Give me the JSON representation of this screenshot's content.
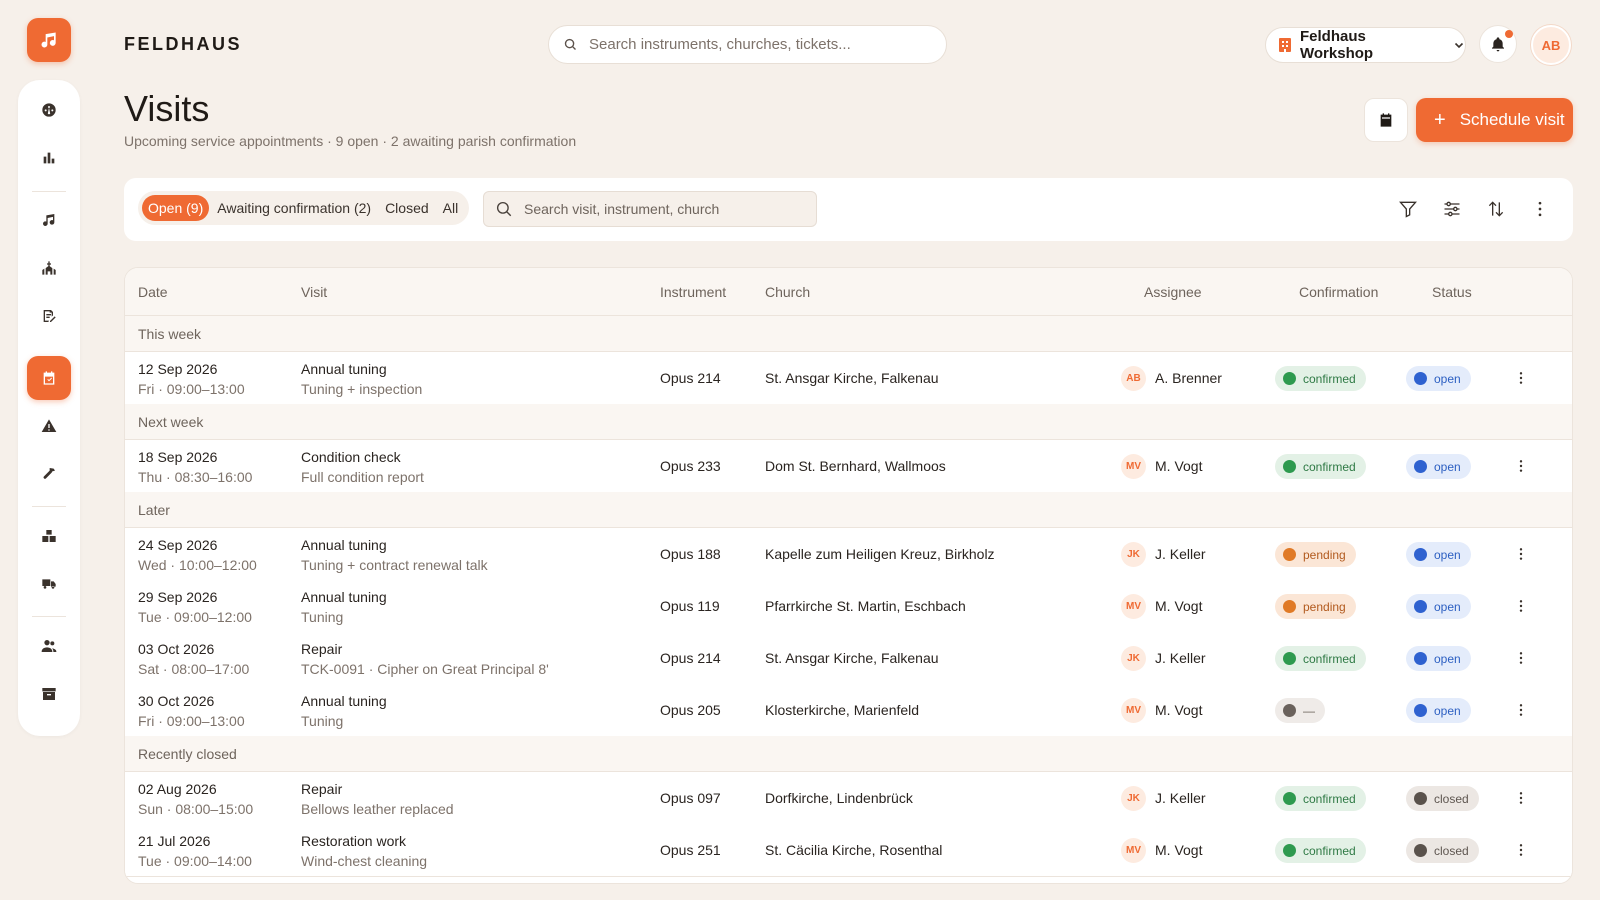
{
  "app": {
    "brand": "FELDHAUS",
    "search_placeholder": "Search instruments, churches, tickets...",
    "workspace": "Feldhaus Workshop",
    "user_initials": "AB"
  },
  "sidebar": {
    "items": [
      {
        "icon": "dashboard-icon"
      },
      {
        "icon": "chart-icon"
      },
      {
        "icon": "music-note-icon"
      },
      {
        "icon": "church-icon"
      },
      {
        "icon": "contract-icon"
      },
      {
        "icon": "calendar-icon",
        "active": true
      },
      {
        "icon": "warning-icon"
      },
      {
        "icon": "hammer-icon"
      },
      {
        "icon": "boxes-icon"
      },
      {
        "icon": "truck-icon"
      },
      {
        "icon": "users-icon"
      },
      {
        "icon": "archive-icon"
      }
    ]
  },
  "page": {
    "title": "Visits",
    "subtitle": "Upcoming service appointments · 9 open · 2 awaiting parish confirmation",
    "primary_action": "Schedule visit"
  },
  "filters": {
    "tabs": [
      "Open (9)",
      "Awaiting confirmation (2)",
      "Closed",
      "All"
    ],
    "active_tab": 0,
    "search_placeholder": "Search visit, instrument, church"
  },
  "table": {
    "columns": [
      "Date",
      "Visit",
      "Instrument",
      "Church",
      "Assignee",
      "Confirmation",
      "Status"
    ],
    "groups": [
      {
        "label": "This week",
        "rows": [
          {
            "date": "12 Sep 2026",
            "time": "Fri · 09:00–13:00",
            "visit": "Annual tuning",
            "visit_sub": "Tuning + inspection",
            "instrument": "Opus 214",
            "church": "St. Ansgar Kirche, Falkenau",
            "initials": "AB",
            "assignee": "A. Brenner",
            "confirmation": "confirmed",
            "status": "open"
          }
        ]
      },
      {
        "label": "Next week",
        "rows": [
          {
            "date": "18 Sep 2026",
            "time": "Thu · 08:30–16:00",
            "visit": "Condition check",
            "visit_sub": "Full condition report",
            "instrument": "Opus 233",
            "church": "Dom St. Bernhard, Wallmoos",
            "initials": "MV",
            "assignee": "M. Vogt",
            "confirmation": "confirmed",
            "status": "open"
          }
        ]
      },
      {
        "label": "Later",
        "rows": [
          {
            "date": "24 Sep 2026",
            "time": "Wed · 10:00–12:00",
            "visit": "Annual tuning",
            "visit_sub": "Tuning + contract renewal talk",
            "instrument": "Opus 188",
            "church": "Kapelle zum Heiligen Kreuz, Birkholz",
            "initials": "JK",
            "assignee": "J. Keller",
            "confirmation": "pending",
            "status": "open"
          },
          {
            "date": "29 Sep 2026",
            "time": "Tue · 09:00–12:00",
            "visit": "Annual tuning",
            "visit_sub": "Tuning",
            "instrument": "Opus 119",
            "church": "Pfarrkirche St. Martin, Eschbach",
            "initials": "MV",
            "assignee": "M. Vogt",
            "confirmation": "pending",
            "status": "open"
          },
          {
            "date": "03 Oct 2026",
            "time": "Sat · 08:00–17:00",
            "visit": "Repair",
            "visit_sub": "TCK-0091 · Cipher on Great Principal 8'",
            "instrument": "Opus 214",
            "church": "St. Ansgar Kirche, Falkenau",
            "initials": "JK",
            "assignee": "J. Keller",
            "confirmation": "confirmed",
            "status": "open"
          },
          {
            "date": "30 Oct 2026",
            "time": "Fri · 09:00–13:00",
            "visit": "Annual tuning",
            "visit_sub": "Tuning",
            "instrument": "Opus 205",
            "church": "Klosterkirche, Marienfeld",
            "initials": "MV",
            "assignee": "M. Vogt",
            "confirmation": "—",
            "status": "open"
          }
        ]
      },
      {
        "label": "Recently closed",
        "rows": [
          {
            "date": "02 Aug 2026",
            "time": "Sun · 08:00–15:00",
            "visit": "Repair",
            "visit_sub": "Bellows leather replaced",
            "instrument": "Opus 097",
            "church": "Dorfkirche, Lindenbrück",
            "initials": "JK",
            "assignee": "J. Keller",
            "confirmation": "confirmed",
            "status": "closed"
          },
          {
            "date": "21 Jul 2026",
            "time": "Tue · 09:00–14:00",
            "visit": "Restoration work",
            "visit_sub": "Wind-chest cleaning",
            "instrument": "Opus 251",
            "church": "St. Cäcilia Kirche, Rosenthal",
            "initials": "MV",
            "assignee": "M. Vogt",
            "confirmation": "confirmed",
            "status": "closed"
          }
        ]
      }
    ]
  },
  "colors": {
    "accent": "#ef6a33",
    "background": "#f6f0ea",
    "confirmed": "#2e9a4f",
    "pending": "#e07a26",
    "open": "#2f62d0",
    "closed": "#5a524c"
  }
}
